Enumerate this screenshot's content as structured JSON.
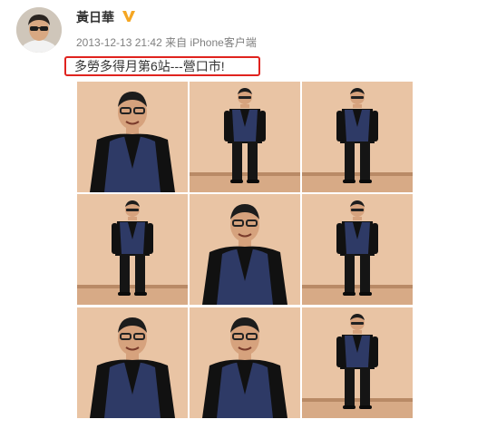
{
  "post": {
    "author": "黃日華",
    "verified_icon": "verified-v-icon",
    "timestamp": "2013-12-13 21:42",
    "source_prefix": "来自",
    "source": "iPhone客户端",
    "text": "多勞多得月第6站---營口市!"
  },
  "colors": {
    "highlight_border": "#e0231f",
    "verified_badge": "#f5a623",
    "jacket": "#2e3a66",
    "wall": "#e9c4a4"
  },
  "photos": [
    {
      "pose": "close"
    },
    {
      "pose": "full"
    },
    {
      "pose": "full"
    },
    {
      "pose": "full"
    },
    {
      "pose": "close"
    },
    {
      "pose": "full"
    },
    {
      "pose": "close"
    },
    {
      "pose": "close"
    },
    {
      "pose": "full"
    }
  ]
}
